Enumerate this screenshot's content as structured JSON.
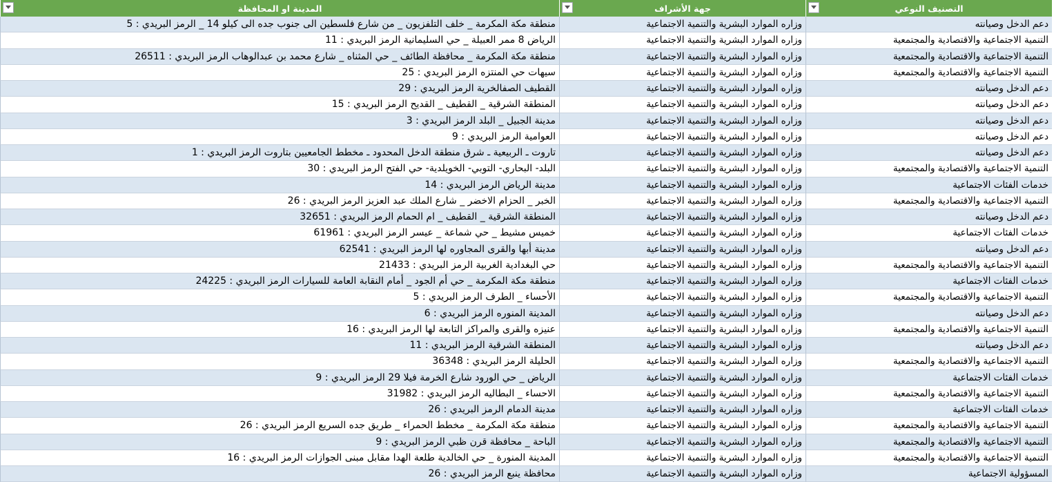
{
  "columns": [
    {
      "key": "c1",
      "label": "التصنيف النوعي"
    },
    {
      "key": "c2",
      "label": "جهة الأشراف"
    },
    {
      "key": "c3",
      "label": "المدينة او المحافظة"
    }
  ],
  "filter_glyph": "▾",
  "rows": [
    {
      "c1": "دعم الدخل وصيانته",
      "c2": "وزاره الموارد البشرية والتنمية الاجتماعية",
      "c3": "منطقة مكة المكرمة _ خلف التلفزيون _ من شارع فلسطين الى جنوب جده الى كيلو 14 _ الرمز البريدي : 5"
    },
    {
      "c1": "التنمية الاجتماعية والاقتصادية والمجتمعية",
      "c2": "وزاره الموارد البشرية والتنمية الاجتماعية",
      "c3": "الرياض 8 ممر العبيلة _ حي السليمانية الرمز البريدي : 11"
    },
    {
      "c1": "التنمية الاجتماعية والاقتصادية والمجتمعية",
      "c2": "وزاره الموارد البشرية والتنمية الاجتماعية",
      "c3": "منطقة مكة المكرمة _ محافظة الطائف _ حي المثناه _ شارع محمد بن عبدالوهاب الرمز البريدي : 26511"
    },
    {
      "c1": "التنمية الاجتماعية والاقتصادية والمجتمعية",
      "c2": "وزاره الموارد البشرية والتنمية الاجتماعية",
      "c3": "سيهات حي المنتزه الرمز البريدي : 25"
    },
    {
      "c1": "دعم الدخل وصيانته",
      "c2": "وزاره الموارد البشرية والتنمية الاجتماعية",
      "c3": "القطيف الصفالخرية الرمز البريدي : 29"
    },
    {
      "c1": "دعم الدخل وصيانته",
      "c2": "وزاره الموارد البشرية والتنمية الاجتماعية",
      "c3": "المنطقة الشرقية _ القطيف _ القديح الرمز البريدي : 15"
    },
    {
      "c1": "دعم الدخل وصيانته",
      "c2": "وزاره الموارد البشرية والتنمية الاجتماعية",
      "c3": "مدينة الجبيل _ البلد الرمز البريدي : 3"
    },
    {
      "c1": "دعم الدخل وصيانته",
      "c2": "وزاره الموارد البشرية والتنمية الاجتماعية",
      "c3": "العوامية الرمز البريدي : 9"
    },
    {
      "c1": "دعم الدخل وصيانته",
      "c2": "وزاره الموارد البشرية والتنمية الاجتماعية",
      "c3": "تاروت ـ الربيعية ـ شرق منطقة الدخل المحدود ـ مخطط الجامعيين بتاروت الرمز البريدي : 1"
    },
    {
      "c1": "التنمية الاجتماعية والاقتصادية والمجتمعية",
      "c2": "وزاره الموارد البشرية والتنمية الاجتماعية",
      "c3": "البلد- البحاري- التوبي- الخويلدية- حي الفتح الرمز البريدي : 30"
    },
    {
      "c1": "خدمات الفئات الاجتماعية",
      "c2": "وزاره الموارد البشرية والتنمية الاجتماعية",
      "c3": "مدينة الرياض الرمز البريدي : 14"
    },
    {
      "c1": "التنمية الاجتماعية والاقتصادية والمجتمعية",
      "c2": "وزاره الموارد البشرية والتنمية الاجتماعية",
      "c3": "الخبر _ الحزام الاخضر _ شارع الملك عبد العزيز الرمز البريدي : 26"
    },
    {
      "c1": "دعم الدخل وصيانته",
      "c2": "وزاره الموارد البشرية والتنمية الاجتماعية",
      "c3": "المنطقة الشرقية _ القطيف _ ام الحمام الرمز البريدي : 32651"
    },
    {
      "c1": "خدمات الفئات الاجتماعية",
      "c2": "وزاره الموارد البشرية والتنمية الاجتماعية",
      "c3": "خميس مشيط _ حي شماعة _ عيسر الرمز البريدي : 61961"
    },
    {
      "c1": "دعم الدخل وصيانته",
      "c2": "وزاره الموارد البشرية والتنمية الاجتماعية",
      "c3": "مدينة أبها والقرى المجاوره لها الرمز البريدي : 62541"
    },
    {
      "c1": "التنمية الاجتماعية والاقتصادية والمجتمعية",
      "c2": "وزاره الموارد البشرية والتنمية الاجتماعية",
      "c3": "حي البغدادية الغربية الرمز البريدي : 21433"
    },
    {
      "c1": "خدمات الفئات الاجتماعية",
      "c2": "وزاره الموارد البشرية والتنمية الاجتماعية",
      "c3": "منطقة مكة المكرمة _ حي أم الجود _ أمام النقابة العامة للسيارات الرمز البريدي : 24225"
    },
    {
      "c1": "التنمية الاجتماعية والاقتصادية والمجتمعية",
      "c2": "وزاره الموارد البشرية والتنمية الاجتماعية",
      "c3": "الأحساء _ الطرف الرمز البريدي : 5"
    },
    {
      "c1": "دعم الدخل وصيانته",
      "c2": "وزاره الموارد البشرية والتنمية الاجتماعية",
      "c3": "المدينة المنوره الرمز البريدي : 6"
    },
    {
      "c1": "التنمية الاجتماعية والاقتصادية والمجتمعية",
      "c2": "وزاره الموارد البشرية والتنمية الاجتماعية",
      "c3": "عنيزه والقرى والمراكز التابعة لها الرمز البريدي : 16"
    },
    {
      "c1": "دعم الدخل وصيانته",
      "c2": "وزاره الموارد البشرية والتنمية الاجتماعية",
      "c3": "المنطقة الشرقية الرمز البريدي : 11"
    },
    {
      "c1": "التنمية الاجتماعية والاقتصادية والمجتمعية",
      "c2": "وزاره الموارد البشرية والتنمية الاجتماعية",
      "c3": "الحليلة الرمز البريدي : 36348"
    },
    {
      "c1": "خدمات الفئات الاجتماعية",
      "c2": "وزاره الموارد البشرية والتنمية الاجتماعية",
      "c3": "الرياض _ حي الورود شارع الخرمة فيلا 29 الرمز البريدي : 9"
    },
    {
      "c1": "التنمية الاجتماعية والاقتصادية والمجتمعية",
      "c2": "وزاره الموارد البشرية والتنمية الاجتماعية",
      "c3": "الاحساء _ البطاليه الرمز البريدي : 31982"
    },
    {
      "c1": "خدمات الفئات الاجتماعية",
      "c2": "وزاره الموارد البشرية والتنمية الاجتماعية",
      "c3": "مدينة الدمام الرمز البريدي : 26"
    },
    {
      "c1": "التنمية الاجتماعية والاقتصادية والمجتمعية",
      "c2": "وزاره الموارد البشرية والتنمية الاجتماعية",
      "c3": "منطقة مكة المكرمة _ مخطط الحمراء _ طريق جده السريع الرمز البريدي : 26"
    },
    {
      "c1": "التنمية الاجتماعية والاقتصادية والمجتمعية",
      "c2": "وزاره الموارد البشرية والتنمية الاجتماعية",
      "c3": "الباحة _ محافظة قرن ظبي الرمز البريدي : 9"
    },
    {
      "c1": "التنمية الاجتماعية والاقتصادية والمجتمعية",
      "c2": "وزاره الموارد البشرية والتنمية الاجتماعية",
      "c3": "المدينة المنورة _ حي الخالدية طلعة الهدا مقابل مبنى الجوازات الرمز البريدي : 16"
    },
    {
      "c1": "المسؤولية الاجتماعية",
      "c2": "وزاره الموارد البشرية والتنمية الاجتماعية",
      "c3": "محافظة ينبع الرمز البريدي : 26"
    }
  ]
}
